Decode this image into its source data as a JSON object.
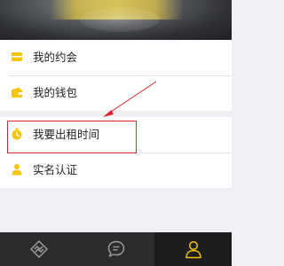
{
  "menu": {
    "group1": [
      {
        "label": "我的约会",
        "icon": "ticket-icon"
      },
      {
        "label": "我的钱包",
        "icon": "wallet-icon"
      }
    ],
    "group2": [
      {
        "label": "我要出租时间",
        "icon": "stopwatch-icon"
      },
      {
        "label": "实名认证",
        "icon": "user-verify-icon"
      }
    ]
  },
  "tabbar": {
    "tabs": [
      {
        "icon": "handshake-icon",
        "active": false
      },
      {
        "icon": "chat-icon",
        "active": false
      },
      {
        "icon": "profile-icon",
        "active": true
      }
    ]
  },
  "colors": {
    "accent": "#f5c400",
    "annotation": "#d9252b",
    "tabbar_bg": "#2c2c2c",
    "tabbar_active_bg": "#1d1d1d",
    "page_bg": "#efeff4"
  }
}
